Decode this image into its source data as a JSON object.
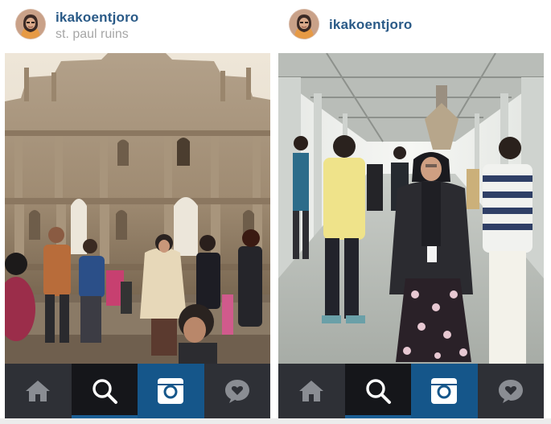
{
  "colors": {
    "username": "#2a5a87",
    "location": "#a6a6a6",
    "tabbar_bg": "#2e3036",
    "tab_active_bg": "#15161a",
    "camera_tab_bg": "#15568a",
    "accent_underline": "#1b5e94"
  },
  "posts": [
    {
      "username": "ikakoentjoro",
      "location": "st. paul ruins",
      "avatar_icon": "user-avatar",
      "photo_subject": "ruins-of-st-paul-facade"
    },
    {
      "username": "ikakoentjoro",
      "location": "",
      "avatar_icon": "user-avatar",
      "photo_subject": "covered-walkway-portrait"
    }
  ],
  "tabbar": {
    "items": [
      {
        "id": "home",
        "icon": "home-icon",
        "active": false
      },
      {
        "id": "explore",
        "icon": "search-icon",
        "active": true
      },
      {
        "id": "camera",
        "icon": "camera-icon",
        "active": false
      },
      {
        "id": "activity",
        "icon": "heart-bubble-icon",
        "active": false
      }
    ]
  }
}
